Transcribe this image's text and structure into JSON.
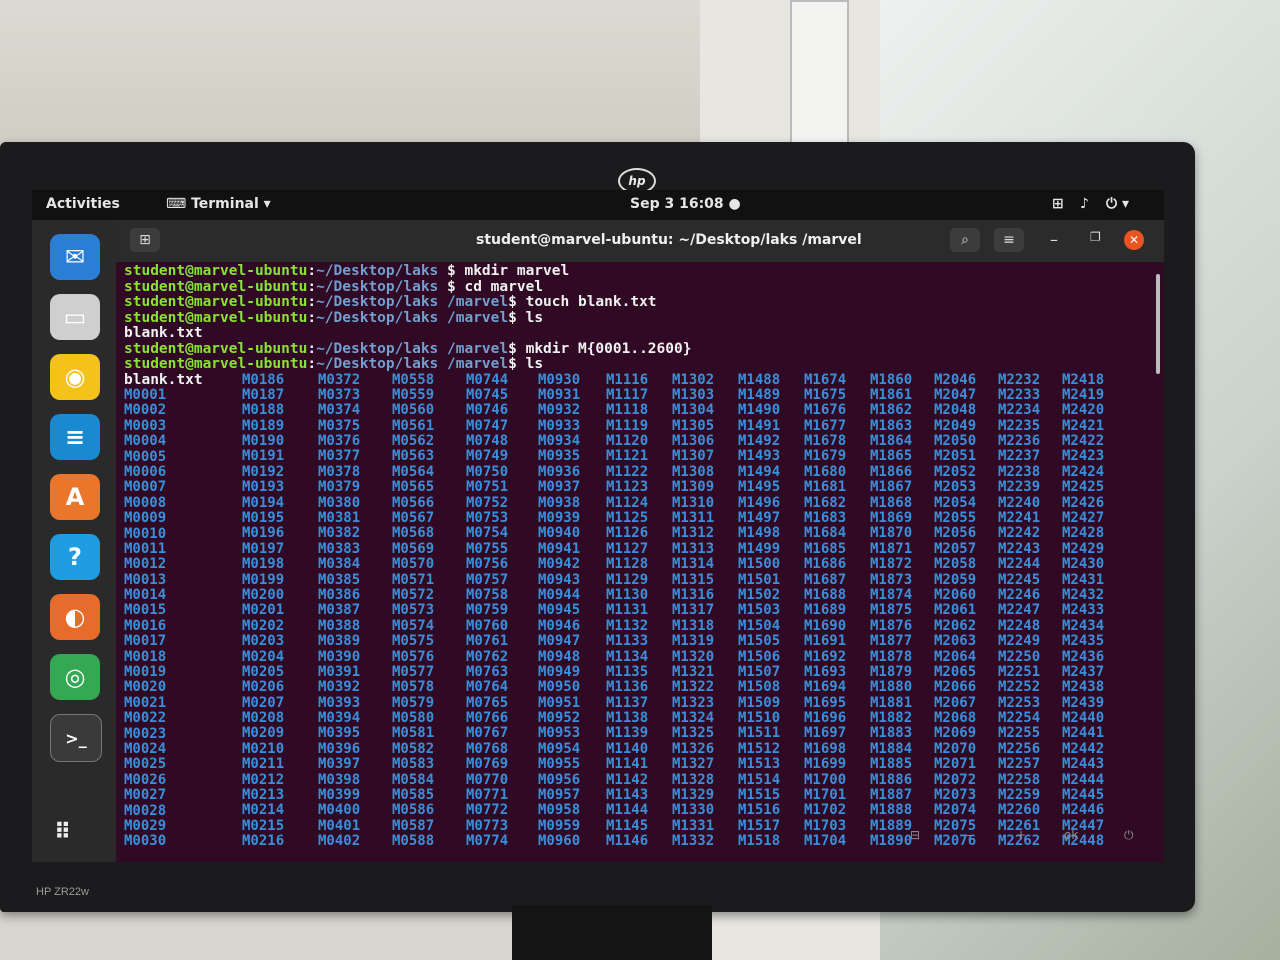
{
  "topbar": {
    "activities": "Activities",
    "app_menu": "Terminal",
    "datetime": "Sep 3  16:08"
  },
  "terminal": {
    "title": "student@marvel-ubuntu: ~/Desktop/laks /marvel",
    "lines": [
      {
        "prompt": "student@marvel-ubuntu",
        "path": "~/Desktop/laks",
        "cmd": " $ mkdir marvel"
      },
      {
        "prompt": "student@marvel-ubuntu",
        "path": "~/Desktop/laks",
        "cmd": " $ cd marvel"
      },
      {
        "prompt": "student@marvel-ubuntu",
        "path": "~/Desktop/laks /marvel",
        "cmd": "$ touch blank.txt"
      },
      {
        "prompt": "student@marvel-ubuntu",
        "path": "~/Desktop/laks /marvel",
        "cmd": "$ ls"
      },
      {
        "output": "blank.txt"
      },
      {
        "prompt": "student@marvel-ubuntu",
        "path": "~/Desktop/laks /marvel",
        "cmd": "$ mkdir M{0001..2600}"
      },
      {
        "prompt": "student@marvel-ubuntu",
        "path": "~/Desktop/laks /marvel",
        "cmd": "$ ls"
      }
    ],
    "ls_first": "blank.txt",
    "ls_columns": [
      [
        "M0001",
        "M0002",
        "M0003",
        "M0004",
        "M0005",
        "M0006",
        "M0007",
        "M0008",
        "M0009",
        "M0010",
        "M0011",
        "M0012",
        "M0013",
        "M0014",
        "M0015",
        "M0016",
        "M0017",
        "M0018",
        "M0019",
        "M0020",
        "M0021",
        "M0022",
        "M0023",
        "M0024",
        "M0025",
        "M0026",
        "M0027",
        "M0028",
        "M0029",
        "M0030"
      ],
      [
        "M0186",
        "M0187",
        "M0188",
        "M0189",
        "M0190",
        "M0191",
        "M0192",
        "M0193",
        "M0194",
        "M0195",
        "M0196",
        "M0197",
        "M0198",
        "M0199",
        "M0200",
        "M0201",
        "M0202",
        "M0203",
        "M0204",
        "M0205",
        "M0206",
        "M0207",
        "M0208",
        "M0209",
        "M0210",
        "M0211",
        "M0212",
        "M0213",
        "M0214",
        "M0215",
        "M0216"
      ],
      [
        "M0372",
        "M0373",
        "M0374",
        "M0375",
        "M0376",
        "M0377",
        "M0378",
        "M0379",
        "M0380",
        "M0381",
        "M0382",
        "M0383",
        "M0384",
        "M0385",
        "M0386",
        "M0387",
        "M0388",
        "M0389",
        "M0390",
        "M0391",
        "M0392",
        "M0393",
        "M0394",
        "M0395",
        "M0396",
        "M0397",
        "M0398",
        "M0399",
        "M0400",
        "M0401",
        "M0402"
      ],
      [
        "M0558",
        "M0559",
        "M0560",
        "M0561",
        "M0562",
        "M0563",
        "M0564",
        "M0565",
        "M0566",
        "M0567",
        "M0568",
        "M0569",
        "M0570",
        "M0571",
        "M0572",
        "M0573",
        "M0574",
        "M0575",
        "M0576",
        "M0577",
        "M0578",
        "M0579",
        "M0580",
        "M0581",
        "M0582",
        "M0583",
        "M0584",
        "M0585",
        "M0586",
        "M0587",
        "M0588"
      ],
      [
        "M0744",
        "M0745",
        "M0746",
        "M0747",
        "M0748",
        "M0749",
        "M0750",
        "M0751",
        "M0752",
        "M0753",
        "M0754",
        "M0755",
        "M0756",
        "M0757",
        "M0758",
        "M0759",
        "M0760",
        "M0761",
        "M0762",
        "M0763",
        "M0764",
        "M0765",
        "M0766",
        "M0767",
        "M0768",
        "M0769",
        "M0770",
        "M0771",
        "M0772",
        "M0773",
        "M0774"
      ],
      [
        "M0930",
        "M0931",
        "M0932",
        "M0933",
        "M0934",
        "M0935",
        "M0936",
        "M0937",
        "M0938",
        "M0939",
        "M0940",
        "M0941",
        "M0942",
        "M0943",
        "M0944",
        "M0945",
        "M0946",
        "M0947",
        "M0948",
        "M0949",
        "M0950",
        "M0951",
        "M0952",
        "M0953",
        "M0954",
        "M0955",
        "M0956",
        "M0957",
        "M0958",
        "M0959",
        "M0960"
      ],
      [
        "M1116",
        "M1117",
        "M1118",
        "M1119",
        "M1120",
        "M1121",
        "M1122",
        "M1123",
        "M1124",
        "M1125",
        "M1126",
        "M1127",
        "M1128",
        "M1129",
        "M1130",
        "M1131",
        "M1132",
        "M1133",
        "M1134",
        "M1135",
        "M1136",
        "M1137",
        "M1138",
        "M1139",
        "M1140",
        "M1141",
        "M1142",
        "M1143",
        "M1144",
        "M1145",
        "M1146"
      ],
      [
        "M1302",
        "M1303",
        "M1304",
        "M1305",
        "M1306",
        "M1307",
        "M1308",
        "M1309",
        "M1310",
        "M1311",
        "M1312",
        "M1313",
        "M1314",
        "M1315",
        "M1316",
        "M1317",
        "M1318",
        "M1319",
        "M1320",
        "M1321",
        "M1322",
        "M1323",
        "M1324",
        "M1325",
        "M1326",
        "M1327",
        "M1328",
        "M1329",
        "M1330",
        "M1331",
        "M1332"
      ],
      [
        "M1488",
        "M1489",
        "M1490",
        "M1491",
        "M1492",
        "M1493",
        "M1494",
        "M1495",
        "M1496",
        "M1497",
        "M1498",
        "M1499",
        "M1500",
        "M1501",
        "M1502",
        "M1503",
        "M1504",
        "M1505",
        "M1506",
        "M1507",
        "M1508",
        "M1509",
        "M1510",
        "M1511",
        "M1512",
        "M1513",
        "M1514",
        "M1515",
        "M1516",
        "M1517",
        "M1518"
      ],
      [
        "M1674",
        "M1675",
        "M1676",
        "M1677",
        "M1678",
        "M1679",
        "M1680",
        "M1681",
        "M1682",
        "M1683",
        "M1684",
        "M1685",
        "M1686",
        "M1687",
        "M1688",
        "M1689",
        "M1690",
        "M1691",
        "M1692",
        "M1693",
        "M1694",
        "M1695",
        "M1696",
        "M1697",
        "M1698",
        "M1699",
        "M1700",
        "M1701",
        "M1702",
        "M1703",
        "M1704"
      ],
      [
        "M1860",
        "M1861",
        "M1862",
        "M1863",
        "M1864",
        "M1865",
        "M1866",
        "M1867",
        "M1868",
        "M1869",
        "M1870",
        "M1871",
        "M1872",
        "M1873",
        "M1874",
        "M1875",
        "M1876",
        "M1877",
        "M1878",
        "M1879",
        "M1880",
        "M1881",
        "M1882",
        "M1883",
        "M1884",
        "M1885",
        "M1886",
        "M1887",
        "M1888",
        "M1889",
        "M1890"
      ],
      [
        "M2046",
        "M2047",
        "M2048",
        "M2049",
        "M2050",
        "M2051",
        "M2052",
        "M2053",
        "M2054",
        "M2055",
        "M2056",
        "M2057",
        "M2058",
        "M2059",
        "M2060",
        "M2061",
        "M2062",
        "M2063",
        "M2064",
        "M2065",
        "M2066",
        "M2067",
        "M2068",
        "M2069",
        "M2070",
        "M2071",
        "M2072",
        "M2073",
        "M2074",
        "M2075",
        "M2076"
      ],
      [
        "M2232",
        "M2233",
        "M2234",
        "M2235",
        "M2236",
        "M2237",
        "M2238",
        "M2239",
        "M2240",
        "M2241",
        "M2242",
        "M2243",
        "M2244",
        "M2245",
        "M2246",
        "M2247",
        "M2248",
        "M2249",
        "M2250",
        "M2251",
        "M2252",
        "M2253",
        "M2254",
        "M2255",
        "M2256",
        "M2257",
        "M2258",
        "M2259",
        "M2260",
        "M2261",
        "M2262"
      ],
      [
        "M2418",
        "M2419",
        "M2420",
        "M2421",
        "M2422",
        "M2423",
        "M2424",
        "M2425",
        "M2426",
        "M2427",
        "M2428",
        "M2429",
        "M2430",
        "M2431",
        "M2432",
        "M2433",
        "M2434",
        "M2435",
        "M2436",
        "M2437",
        "M2438",
        "M2439",
        "M2440",
        "M2441",
        "M2442",
        "M2443",
        "M2444",
        "M2445",
        "M2446",
        "M2447",
        "M2448"
      ]
    ]
  },
  "monitor": {
    "model": "HP ZR22w",
    "brand": "hp"
  },
  "dock": {
    "items": [
      {
        "name": "thunderbird-icon",
        "glyph": "✉",
        "color": "#2a7fd4"
      },
      {
        "name": "files-icon",
        "glyph": "▭",
        "color": "#cfcfcf"
      },
      {
        "name": "rhythmbox-icon",
        "glyph": "◉",
        "color": "#f4c21b"
      },
      {
        "name": "writer-icon",
        "glyph": "≡",
        "color": "#1a8ad0"
      },
      {
        "name": "software-icon",
        "glyph": "A",
        "color": "#e9762a"
      },
      {
        "name": "help-icon",
        "glyph": "?",
        "color": "#1f9de2"
      },
      {
        "name": "firefox-icon",
        "glyph": "◐",
        "color": "#e76b2b"
      },
      {
        "name": "chrome-icon",
        "glyph": "◎",
        "color": "#34a853"
      },
      {
        "name": "terminal-icon",
        "glyph": ">_",
        "color": "#3a3a3a"
      }
    ]
  }
}
